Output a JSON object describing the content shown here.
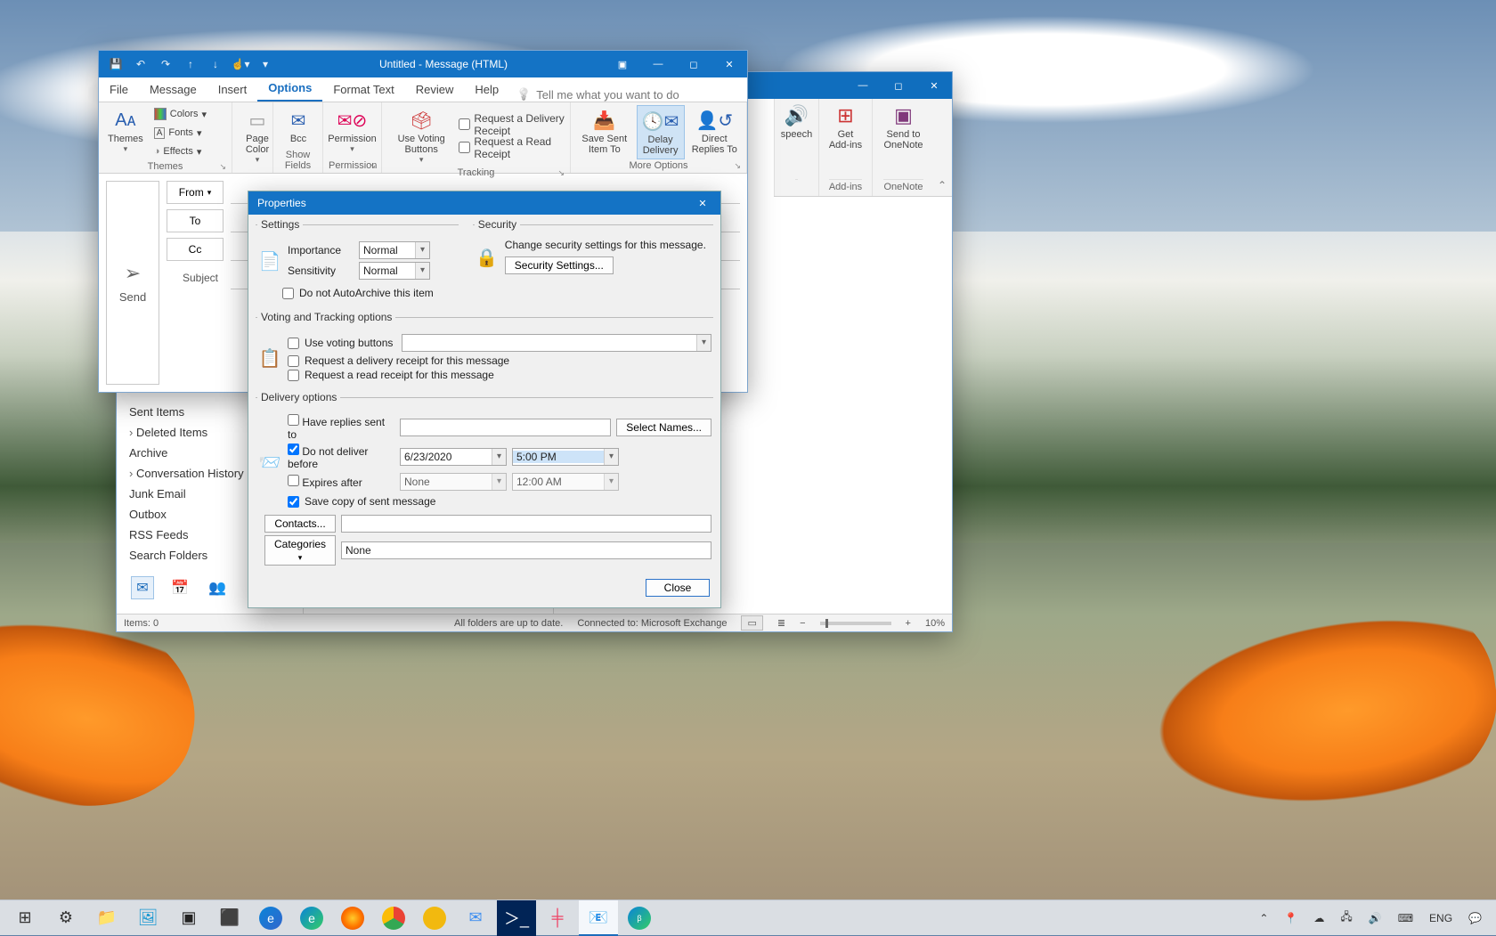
{
  "message_window": {
    "title": "Untitled  -  Message (HTML)",
    "tabs": [
      "File",
      "Message",
      "Insert",
      "Options",
      "Format Text",
      "Review",
      "Help"
    ],
    "active_tab": "Options",
    "tell_me": "Tell me what you want to do",
    "ribbon": {
      "themes": {
        "label": "Themes",
        "colors": "Colors",
        "fonts": "Fonts",
        "effects": "Effects",
        "btn": "Themes"
      },
      "page_color": {
        "label": "Page Color"
      },
      "bcc": "Bcc",
      "show_fields": "Show Fields",
      "permission": {
        "btn": "Permission",
        "group": "Permission"
      },
      "voting": {
        "btn": "Use Voting Buttons"
      },
      "tracking": {
        "group": "Tracking",
        "req_delivery": "Request a Delivery Receipt",
        "req_read": "Request a Read Receipt"
      },
      "save_sent": "Save Sent Item To",
      "delay": "Delay Delivery",
      "direct": "Direct Replies To",
      "more": "More Options"
    },
    "compose": {
      "send": "Send",
      "from": "From",
      "to": "To",
      "cc": "Cc",
      "subject": "Subject"
    }
  },
  "outlook_main": {
    "sidebar": [
      "Sent Items",
      "Deleted Items",
      "Archive",
      "Conversation History",
      "Junk Email",
      "Outbox",
      "RSS Feeds",
      "Search Folders"
    ],
    "sidebar_expandable": [
      1,
      3
    ],
    "ribbon_right": {
      "speech": "speech",
      "addins_btn": "Get Add-ins",
      "addins_grp": "Add-ins",
      "onenote_btn": "Send to OneNote",
      "onenote_grp": "OneNote"
    },
    "status": {
      "items": "Items: 0",
      "folders": "All folders are up to date.",
      "conn": "Connected to: Microsoft Exchange",
      "zoom": "10%"
    }
  },
  "properties": {
    "title": "Properties",
    "settings_legend": "Settings",
    "security_legend": "Security",
    "importance_label": "Importance",
    "importance_value": "Normal",
    "sensitivity_label": "Sensitivity",
    "sensitivity_value": "Normal",
    "no_autoarchive": "Do not AutoArchive this item",
    "security_desc": "Change security settings for this message.",
    "security_btn": "Security Settings...",
    "voting_legend": "Voting and Tracking options",
    "use_voting": "Use voting buttons",
    "req_del": "Request a delivery receipt for this message",
    "req_read": "Request a read receipt for this message",
    "delivery_legend": "Delivery options",
    "replies": "Have replies sent to",
    "select_names": "Select Names...",
    "deliver_before": "Do not deliver before",
    "deliver_date": "6/23/2020",
    "deliver_time": "5:00 PM",
    "expires": "Expires after",
    "expires_date": "None",
    "expires_time": "12:00 AM",
    "save_copy": "Save copy of sent message",
    "contacts": "Contacts...",
    "categories": "Categories",
    "categories_value": "None",
    "close": "Close"
  },
  "taskbar": {
    "tray_lang": "ENG",
    "tray_time": ""
  }
}
